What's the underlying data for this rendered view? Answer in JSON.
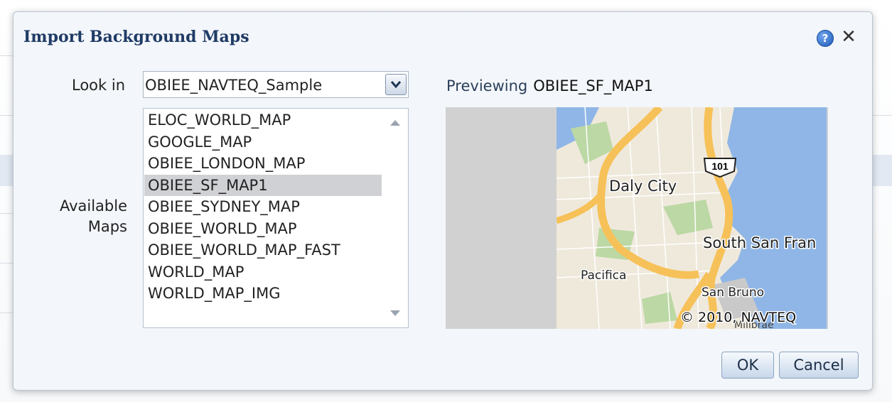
{
  "dialog": {
    "title": "Import Background Maps",
    "help_icon": "question-circle-icon",
    "close_icon": "close-icon",
    "close_glyph": "✕",
    "help_glyph": "?"
  },
  "look_in": {
    "label": "Look in",
    "value": "OBIEE_NAVTEQ_Sample"
  },
  "available_maps": {
    "label_line1": "Available",
    "label_line2": "Maps",
    "items": [
      "ELOC_WORLD_MAP",
      "GOOGLE_MAP",
      "OBIEE_LONDON_MAP",
      "OBIEE_SF_MAP1",
      "OBIEE_SYDNEY_MAP",
      "OBIEE_WORLD_MAP",
      "OBIEE_WORLD_MAP_FAST",
      "WORLD_MAP",
      "WORLD_MAP_IMG"
    ],
    "selected": "OBIEE_SF_MAP1"
  },
  "preview": {
    "label": "Previewing",
    "map_name": "OBIEE_SF_MAP1",
    "map_labels": {
      "city1": "Daly City",
      "city2": "South San Fran",
      "city3": "Pacifica",
      "city4": "San Bruno",
      "city5": "Millbrae",
      "highway": "101",
      "copyright": "© 2010, NAVTEQ"
    }
  },
  "buttons": {
    "ok": "OK",
    "cancel": "Cancel"
  },
  "colors": {
    "title": "#1f3b66",
    "selected_row": "#cfd1d4",
    "water": "#8fb6e6",
    "land": "#efe9dc",
    "park": "#bcd8a4",
    "highway": "#f6c158"
  }
}
